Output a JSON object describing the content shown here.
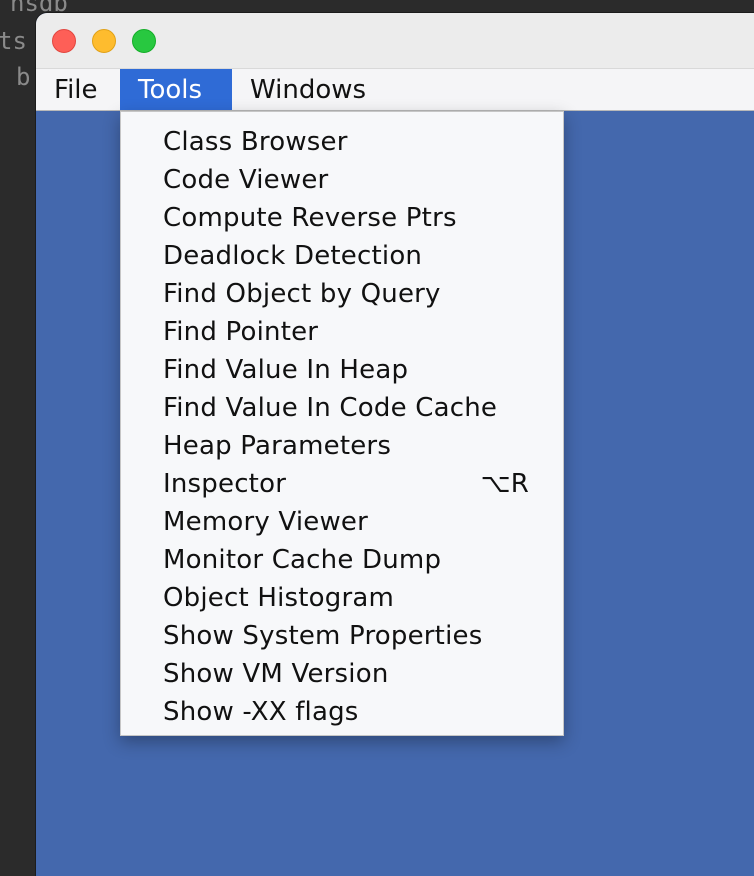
{
  "background": {
    "lines": [
      "nsdb",
      "ts",
      "b"
    ]
  },
  "window": {
    "buttons": {
      "close": "close",
      "minimize": "minimize",
      "zoom": "zoom"
    },
    "colors": {
      "content_bg": "#4468ad",
      "active_menu": "#2f6bd6"
    }
  },
  "menubar": {
    "items": [
      {
        "label": "File"
      },
      {
        "label": "Tools"
      },
      {
        "label": "Windows"
      }
    ],
    "active": "Tools"
  },
  "tools_menu": {
    "items": [
      {
        "label": "Class Browser",
        "shortcut": ""
      },
      {
        "label": "Code Viewer",
        "shortcut": ""
      },
      {
        "label": "Compute Reverse Ptrs",
        "shortcut": ""
      },
      {
        "label": "Deadlock Detection",
        "shortcut": ""
      },
      {
        "label": "Find Object by Query",
        "shortcut": ""
      },
      {
        "label": "Find Pointer",
        "shortcut": ""
      },
      {
        "label": "Find Value In Heap",
        "shortcut": ""
      },
      {
        "label": "Find Value In Code Cache",
        "shortcut": ""
      },
      {
        "label": "Heap Parameters",
        "shortcut": ""
      },
      {
        "label": "Inspector",
        "shortcut": "⌥R"
      },
      {
        "label": "Memory Viewer",
        "shortcut": ""
      },
      {
        "label": "Monitor Cache Dump",
        "shortcut": ""
      },
      {
        "label": "Object Histogram",
        "shortcut": ""
      },
      {
        "label": "Show System Properties",
        "shortcut": ""
      },
      {
        "label": "Show VM Version",
        "shortcut": ""
      },
      {
        "label": "Show -XX flags",
        "shortcut": ""
      }
    ]
  }
}
